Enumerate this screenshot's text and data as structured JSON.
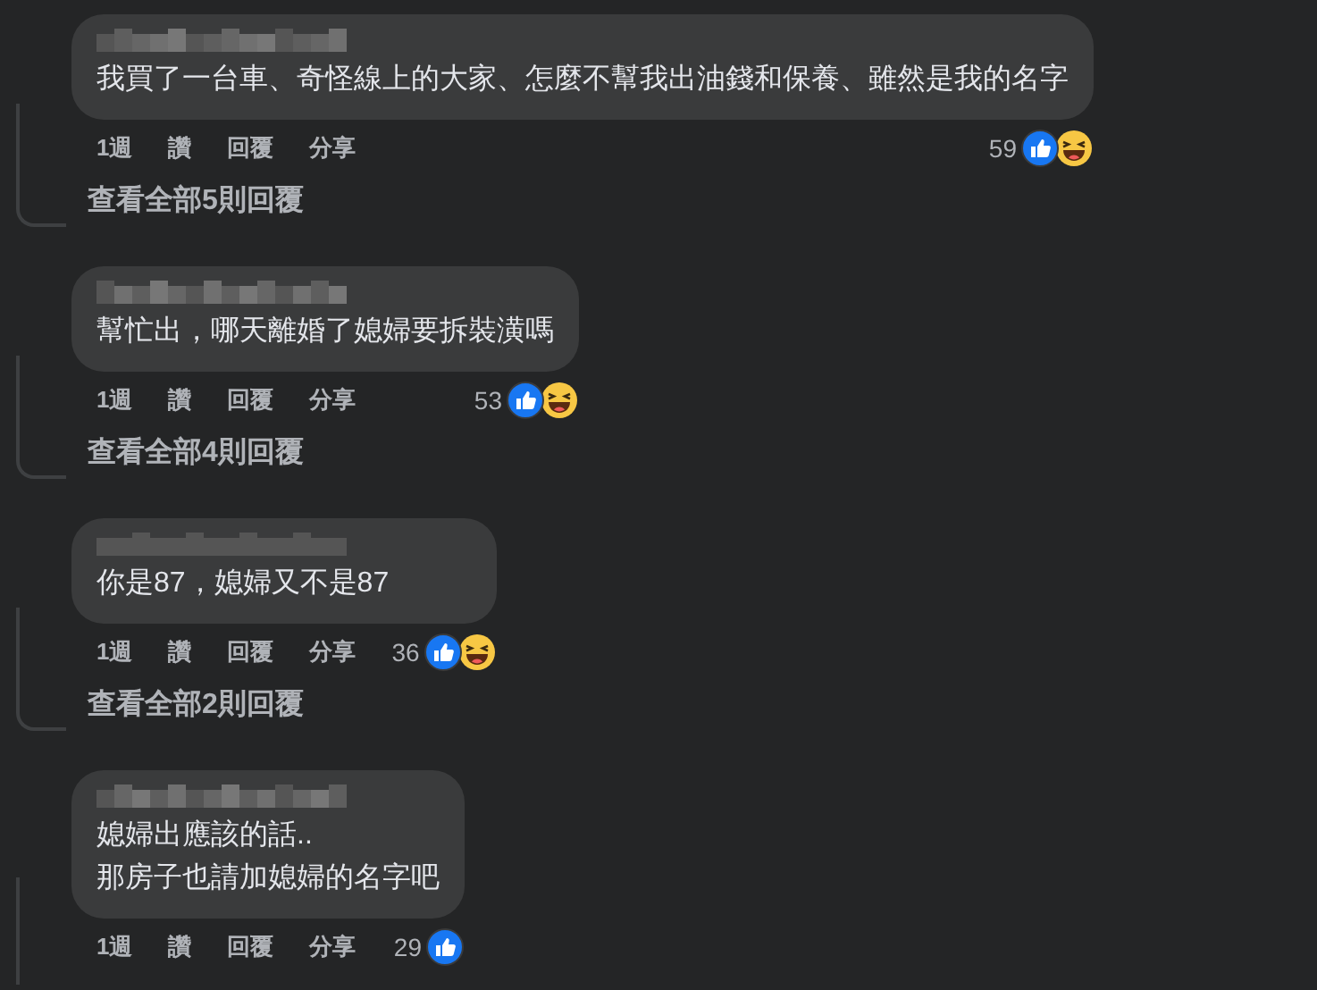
{
  "comments": [
    {
      "text": "我買了一台車、奇怪線上的大家、怎麼不幫我出油錢和保養、雖然是我的名字",
      "actions": [
        "1週",
        "讚",
        "回覆",
        "分享"
      ],
      "reaction_count": "59",
      "reactions": [
        {
          "kind": "like"
        },
        {
          "kind": "haha"
        }
      ],
      "view_replies": "查看全部5則回覆"
    },
    {
      "text": "幫忙出，哪天離婚了媳婦要拆裝潢嗎",
      "actions": [
        "1週",
        "讚",
        "回覆",
        "分享"
      ],
      "reaction_count": "53",
      "reactions": [
        {
          "kind": "like"
        },
        {
          "kind": "haha"
        }
      ],
      "view_replies": "查看全部4則回覆"
    },
    {
      "text": "你是87，媳婦又不是87",
      "actions": [
        "1週",
        "讚",
        "回覆",
        "分享"
      ],
      "reaction_count": "36",
      "reactions": [
        {
          "kind": "like"
        },
        {
          "kind": "haha"
        }
      ],
      "view_replies": "查看全部2則回覆"
    },
    {
      "text": "媳婦出應該的話..\n那房子也請加媳婦的名字吧",
      "actions": [
        "1週",
        "讚",
        "回覆",
        "分享"
      ],
      "reaction_count": "29",
      "reactions": [
        {
          "kind": "like"
        }
      ]
    }
  ]
}
